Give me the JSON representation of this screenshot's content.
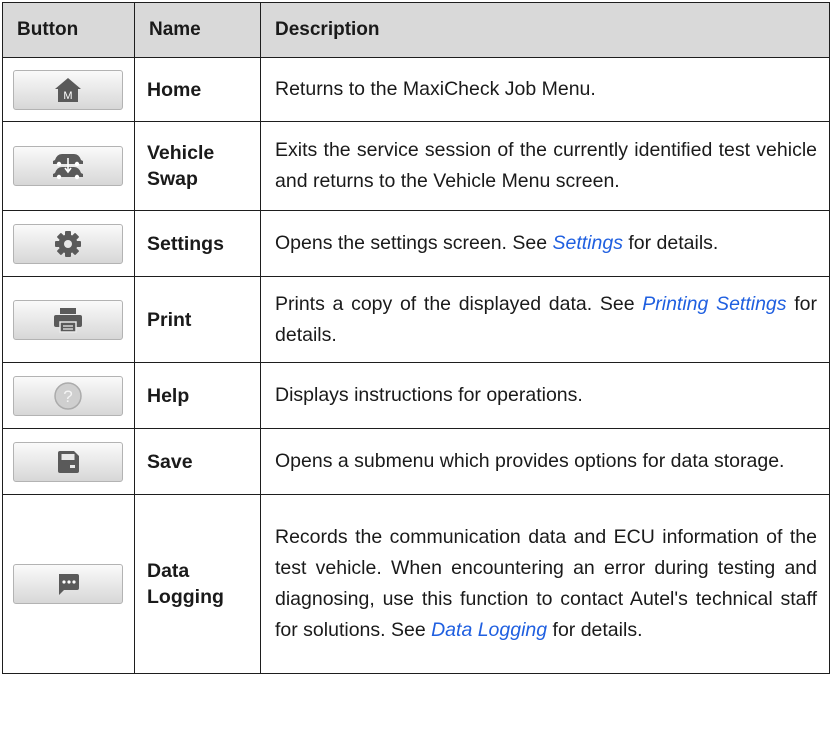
{
  "header": {
    "button": "Button",
    "name": "Name",
    "description": "Description"
  },
  "rows": [
    {
      "name": "Home",
      "icon": "home-m-icon",
      "desc": "Returns to the MaxiCheck Job Menu."
    },
    {
      "name_line1": "Vehicle",
      "name_line2": "Swap",
      "icon": "vehicle-swap-icon",
      "desc": "Exits the service session of the currently identified test vehicle and returns to the Vehicle Menu screen."
    },
    {
      "name": "Settings",
      "icon": "gear-icon",
      "desc_pre": "Opens the settings screen. See ",
      "desc_link": "Settings",
      "desc_post": " for details."
    },
    {
      "name": "Print",
      "icon": "printer-icon",
      "desc_pre": "Prints a copy of the displayed data. See ",
      "desc_link": "Printing Settings",
      "desc_post": " for details."
    },
    {
      "name": "Help",
      "icon": "help-question-icon",
      "desc": "Displays instructions for operations."
    },
    {
      "name": "Save",
      "icon": "save-icon",
      "desc": "Opens a submenu which provides options for data storage."
    },
    {
      "name_line1": "Data",
      "name_line2": "Logging",
      "icon": "chat-bubble-icon",
      "desc_pre": "Records the communication data and ECU information of the test vehicle. When encountering an error during testing and diagnosing, use this function to contact Autel's technical staff for solutions. See ",
      "desc_link": "Data Logging",
      "desc_post": " for details."
    }
  ],
  "colors": {
    "link": "#1f5fe0",
    "header_bg": "#d9d9d9",
    "icon": "#5a5a5a"
  }
}
